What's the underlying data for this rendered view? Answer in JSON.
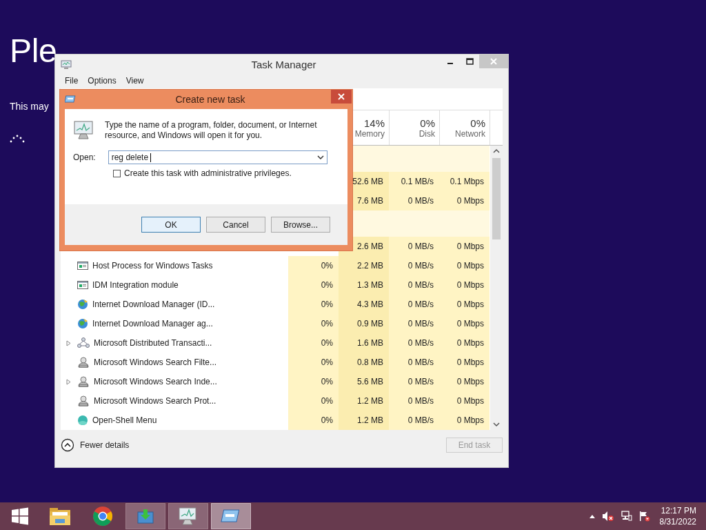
{
  "setup": {
    "title": "Ple",
    "subtitle": "This may"
  },
  "task_manager": {
    "title": "Task Manager",
    "menu": [
      "File",
      "Options",
      "View"
    ],
    "columns": [
      {
        "percent": "14%",
        "label": "Memory"
      },
      {
        "percent": "0%",
        "label": "Disk"
      },
      {
        "percent": "0%",
        "label": "Network"
      }
    ],
    "rows": [
      {
        "kind": "group"
      },
      {
        "kind": "covered",
        "memory": "52.6 MB",
        "disk": "0.1 MB/s",
        "network": "0.1 Mbps"
      },
      {
        "kind": "covered",
        "memory": "7.6 MB",
        "disk": "0 MB/s",
        "network": "0 Mbps"
      },
      {
        "kind": "group"
      },
      {
        "kind": "covered",
        "memory": "2.6 MB",
        "disk": "0 MB/s",
        "network": "0 Mbps"
      },
      {
        "kind": "window",
        "name": "Host Process for Windows Tasks",
        "expandable": false,
        "cpu": "0%",
        "memory": "2.2 MB",
        "disk": "0 MB/s",
        "network": "0 Mbps"
      },
      {
        "kind": "window",
        "name": "IDM Integration module",
        "expandable": false,
        "cpu": "0%",
        "memory": "1.3 MB",
        "disk": "0 MB/s",
        "network": "0 Mbps"
      },
      {
        "kind": "globe",
        "name": "Internet Download Manager (ID...",
        "expandable": false,
        "cpu": "0%",
        "memory": "4.3 MB",
        "disk": "0 MB/s",
        "network": "0 Mbps"
      },
      {
        "kind": "globe",
        "name": "Internet Download Manager ag...",
        "expandable": false,
        "cpu": "0%",
        "memory": "0.9 MB",
        "disk": "0 MB/s",
        "network": "0 Mbps"
      },
      {
        "kind": "service",
        "name": "Microsoft Distributed Transacti...",
        "expandable": true,
        "cpu": "0%",
        "memory": "1.6 MB",
        "disk": "0 MB/s",
        "network": "0 Mbps"
      },
      {
        "kind": "user",
        "name": "Microsoft Windows Search Filte...",
        "expandable": false,
        "cpu": "0%",
        "memory": "0.8 MB",
        "disk": "0 MB/s",
        "network": "0 Mbps"
      },
      {
        "kind": "user",
        "name": "Microsoft Windows Search Inde...",
        "expandable": true,
        "cpu": "0%",
        "memory": "5.6 MB",
        "disk": "0 MB/s",
        "network": "0 Mbps"
      },
      {
        "kind": "user",
        "name": "Microsoft Windows Search Prot...",
        "expandable": false,
        "cpu": "0%",
        "memory": "1.2 MB",
        "disk": "0 MB/s",
        "network": "0 Mbps"
      },
      {
        "kind": "shell",
        "name": "Open-Shell Menu",
        "expandable": false,
        "cpu": "0%",
        "memory": "1.2 MB",
        "disk": "0 MB/s",
        "network": "0 Mbps"
      }
    ],
    "footer": {
      "toggle": "Fewer details",
      "end_task": {
        "label": "End task",
        "disabled": true
      }
    }
  },
  "dialog": {
    "title": "Create new task",
    "message": "Type the name of a program, folder, document, or Internet resource, and Windows will open it for you.",
    "open_label": "Open:",
    "open_value": "reg delete",
    "admin_checkbox": {
      "label": "Create this task with administrative privileges.",
      "checked": false
    },
    "buttons": [
      {
        "label": "OK",
        "default": true
      },
      {
        "label": "Cancel",
        "default": false
      },
      {
        "label": "Browse...",
        "default": false
      }
    ]
  },
  "taskbar": {
    "apps": [
      {
        "kind": "folder",
        "running": false,
        "selected": false
      },
      {
        "kind": "browser",
        "running": false,
        "selected": false
      },
      {
        "kind": "download",
        "running": true,
        "selected": false
      },
      {
        "kind": "monitor",
        "running": true,
        "selected": false
      },
      {
        "kind": "run",
        "running": true,
        "selected": true
      }
    ],
    "clock": {
      "time": "12:17 PM",
      "date": "8/31/2022"
    }
  }
}
